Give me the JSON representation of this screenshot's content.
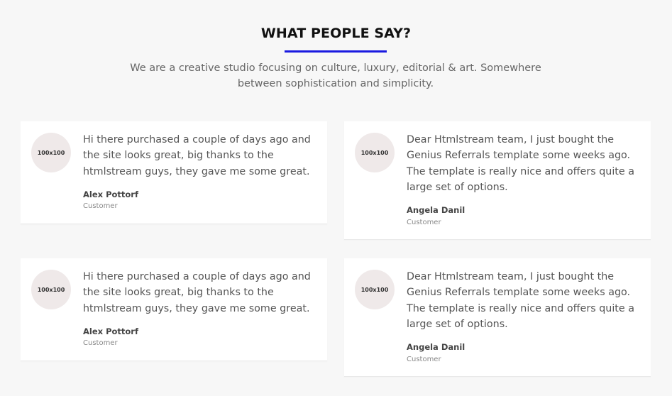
{
  "section": {
    "title": "WHAT PEOPLE SAY?",
    "subtitle": "We are a creative studio focusing on culture, luxury, editorial & art. Somewhere between sophistication and simplicity."
  },
  "colors": {
    "accent": "#1a1ae0",
    "background": "#f7f7f7",
    "card": "#ffffff",
    "avatar": "#efe9e9"
  },
  "testimonials": [
    {
      "avatar_label": "100x100",
      "quote": "Hi there purchased a couple of days ago and the site looks great, big thanks to the htmlstream guys, they gave me some great.",
      "name": "Alex Pottorf",
      "role": "Customer"
    },
    {
      "avatar_label": "100x100",
      "quote": "Dear Htmlstream team, I just bought the Genius Referrals template some weeks ago. The template is really nice and offers quite a large set of options.",
      "name": "Angela Danil",
      "role": "Customer"
    },
    {
      "avatar_label": "100x100",
      "quote": "Hi there purchased a couple of days ago and the site looks great, big thanks to the htmlstream guys, they gave me some great.",
      "name": "Alex Pottorf",
      "role": "Customer"
    },
    {
      "avatar_label": "100x100",
      "quote": "Dear Htmlstream team, I just bought the Genius Referrals template some weeks ago. The template is really nice and offers quite a large set of options.",
      "name": "Angela Danil",
      "role": "Customer"
    }
  ]
}
